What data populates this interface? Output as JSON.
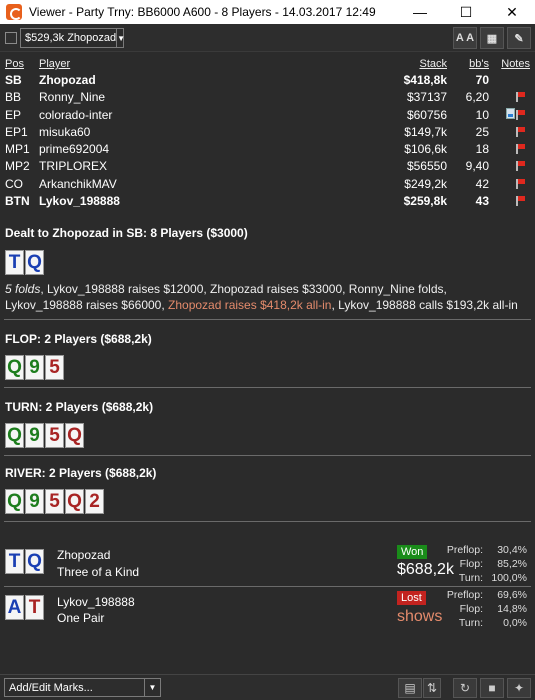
{
  "window": {
    "title": "Viewer - Party Trny: BB6000 A600 - 8 Players - 14.03.2017 12:49",
    "minimize": "—",
    "maximize": "☐",
    "close": "✕"
  },
  "toolbar": {
    "player_select": "$529,3k Zhopozad",
    "font_button": "A A",
    "grid_button": "▦",
    "edit_button": "✎"
  },
  "table": {
    "headers": {
      "pos": "Pos",
      "player": "Player",
      "stack": "Stack",
      "bbs": "bb's",
      "notes": "Notes"
    },
    "rows": [
      {
        "pos": "SB",
        "player": "Zhopozad",
        "stack": "$418,8k",
        "bbs": "70",
        "bold": true,
        "flag": false
      },
      {
        "pos": "BB",
        "player": "Ronny_Nine",
        "stack": "$37137",
        "bbs": "6,20",
        "bold": false,
        "flag": true
      },
      {
        "pos": "EP",
        "player": "colorado-inter",
        "stack": "$60756",
        "bbs": "10",
        "bold": false,
        "flag": true,
        "note": true
      },
      {
        "pos": "EP1",
        "player": "misuka60",
        "stack": "$149,7k",
        "bbs": "25",
        "bold": false,
        "flag": true
      },
      {
        "pos": "MP1",
        "player": "prime692004",
        "stack": "$106,6k",
        "bbs": "18",
        "bold": false,
        "flag": true
      },
      {
        "pos": "MP2",
        "player": "TRIPLOREX",
        "stack": "$56550",
        "bbs": "9,40",
        "bold": false,
        "flag": true
      },
      {
        "pos": "CO",
        "player": "ArkanchikMAV",
        "stack": "$249,2k",
        "bbs": "42",
        "bold": false,
        "flag": true
      },
      {
        "pos": "BTN",
        "player": "Lykov_198888",
        "stack": "$259,8k",
        "bbs": "43",
        "bold": true,
        "flag": true
      }
    ]
  },
  "preflop": {
    "heading": "Dealt to Zhopozad in SB: 8 Players ($3000)",
    "cards": [
      {
        "rank": "T",
        "suit": "blue"
      },
      {
        "rank": "Q",
        "suit": "blue"
      }
    ],
    "folds": "5 folds",
    "action_1": ", Lykov_198888 raises $12000, Zhopozad raises $33000, Ronny_Nine folds, Lykov_198888 raises $66000, ",
    "hero_action": "Zhopozad raises $418,2k all-in",
    "action_2": ", Lykov_198888 calls $193,2k all-in"
  },
  "flop": {
    "heading": "FLOP: 2 Players ($688,2k)",
    "cards": [
      {
        "rank": "Q",
        "suit": "green"
      },
      {
        "rank": "9",
        "suit": "green"
      },
      {
        "rank": "5",
        "suit": "red"
      }
    ]
  },
  "turn": {
    "heading": "TURN: 2 Players ($688,2k)",
    "cards": [
      {
        "rank": "Q",
        "suit": "green"
      },
      {
        "rank": "9",
        "suit": "green"
      },
      {
        "rank": "5",
        "suit": "red"
      },
      {
        "rank": "Q",
        "suit": "red"
      }
    ]
  },
  "river": {
    "heading": "RIVER: 2 Players ($688,2k)",
    "cards": [
      {
        "rank": "Q",
        "suit": "green"
      },
      {
        "rank": "9",
        "suit": "green"
      },
      {
        "rank": "5",
        "suit": "red"
      },
      {
        "rank": "Q",
        "suit": "red"
      },
      {
        "rank": "2",
        "suit": "red"
      }
    ]
  },
  "results": [
    {
      "cards": [
        {
          "rank": "T",
          "suit": "blue"
        },
        {
          "rank": "Q",
          "suit": "blue"
        }
      ],
      "name": "Zhopozad",
      "hand": "Three of a Kind",
      "status": "Won",
      "amount": "$688,2k",
      "equity": {
        "preflop_label": "Preflop:",
        "preflop": "30,4%",
        "flop_label": "Flop:",
        "flop": "85,2%",
        "turn_label": "Turn:",
        "turn": "100,0%"
      }
    },
    {
      "cards": [
        {
          "rank": "A",
          "suit": "blue"
        },
        {
          "rank": "T",
          "suit": "red"
        }
      ],
      "name": "Lykov_198888",
      "hand": "One Pair",
      "status": "Lost",
      "amount": "shows",
      "equity": {
        "preflop_label": "Preflop:",
        "preflop": "69,6%",
        "flop_label": "Flop:",
        "flop": "14,8%",
        "turn_label": "Turn:",
        "turn": "0,0%"
      }
    }
  ],
  "bottom": {
    "marks_select": "Add/Edit Marks...",
    "clipboard_button": "▤",
    "updown_button": "⇅",
    "refresh_button": "↻",
    "save_button": "■",
    "twitter_button": "✦"
  },
  "colors": {
    "background": "#2b2b2b",
    "won": "#1a8c1a",
    "lost": "#c3231f",
    "hero_highlight": "#e48b6c",
    "card_blue": "#1a3fb3",
    "card_green": "#1d7d1d",
    "card_red": "#a82424"
  }
}
